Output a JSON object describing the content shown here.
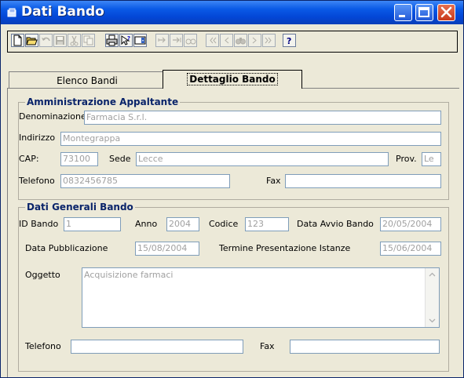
{
  "window": {
    "title": "Dati Bando",
    "colors": {
      "titlebar": "#0346d6",
      "close": "#c8391c",
      "group_title": "#0a246a"
    }
  },
  "toolbar": {
    "buttons": [
      {
        "icon": "new-document-icon"
      },
      {
        "icon": "open-folder-icon"
      },
      {
        "icon": "undo-icon"
      },
      {
        "icon": "save-icon"
      },
      {
        "icon": "cut-icon"
      },
      {
        "icon": "copy-icon"
      },
      {
        "icon": "print-icon"
      },
      {
        "icon": "help-context-icon"
      },
      {
        "icon": "dropdown-icon"
      },
      {
        "icon": "add-record-icon"
      },
      {
        "icon": "remove-record-icon"
      },
      {
        "icon": "edit-record-icon"
      },
      {
        "icon": "first-record-icon"
      },
      {
        "icon": "previous-record-icon"
      },
      {
        "icon": "find-icon"
      },
      {
        "icon": "next-record-icon"
      },
      {
        "icon": "last-record-icon"
      },
      {
        "icon": "help-icon"
      }
    ],
    "help_label": "?"
  },
  "tabs": [
    {
      "label": "Elenco Bandi",
      "active": false
    },
    {
      "label": "Dettaglio Bando",
      "active": true
    }
  ],
  "amministrazione": {
    "title": "Amministrazione Appaltante",
    "denominazione_label": "Denominazione",
    "denominazione_value": "Farmacia S.r.l.",
    "indirizzo_label": "Indirizzo",
    "indirizzo_value": "Montegrappa",
    "cap_label": "CAP:",
    "cap_value": "73100",
    "sede_label": "Sede",
    "sede_value": "Lecce",
    "prov_label": "Prov.",
    "prov_value": "Le",
    "telefono_label": "Telefono",
    "telefono_value": "0832456785",
    "fax_label": "Fax",
    "fax_value": ""
  },
  "dati_generali": {
    "title": "Dati Generali Bando",
    "id_label": "ID Bando",
    "id_value": "1",
    "anno_label": "Anno",
    "anno_value": "2004",
    "codice_label": "Codice",
    "codice_value": "123",
    "data_avvio_label": "Data Avvio Bando",
    "data_avvio_value": "20/05/2004",
    "data_pubblicazione_label": "Data Pubblicazione",
    "data_pubblicazione_value": "15/08/2004",
    "termine_label": "Termine Presentazione Istanze",
    "termine_value": "15/06/2004",
    "oggetto_label": "Oggetto",
    "oggetto_value": "Acquisizione farmaci",
    "telefono_label": "Telefono",
    "telefono_value": "",
    "fax_label": "Fax",
    "fax_value": ""
  }
}
